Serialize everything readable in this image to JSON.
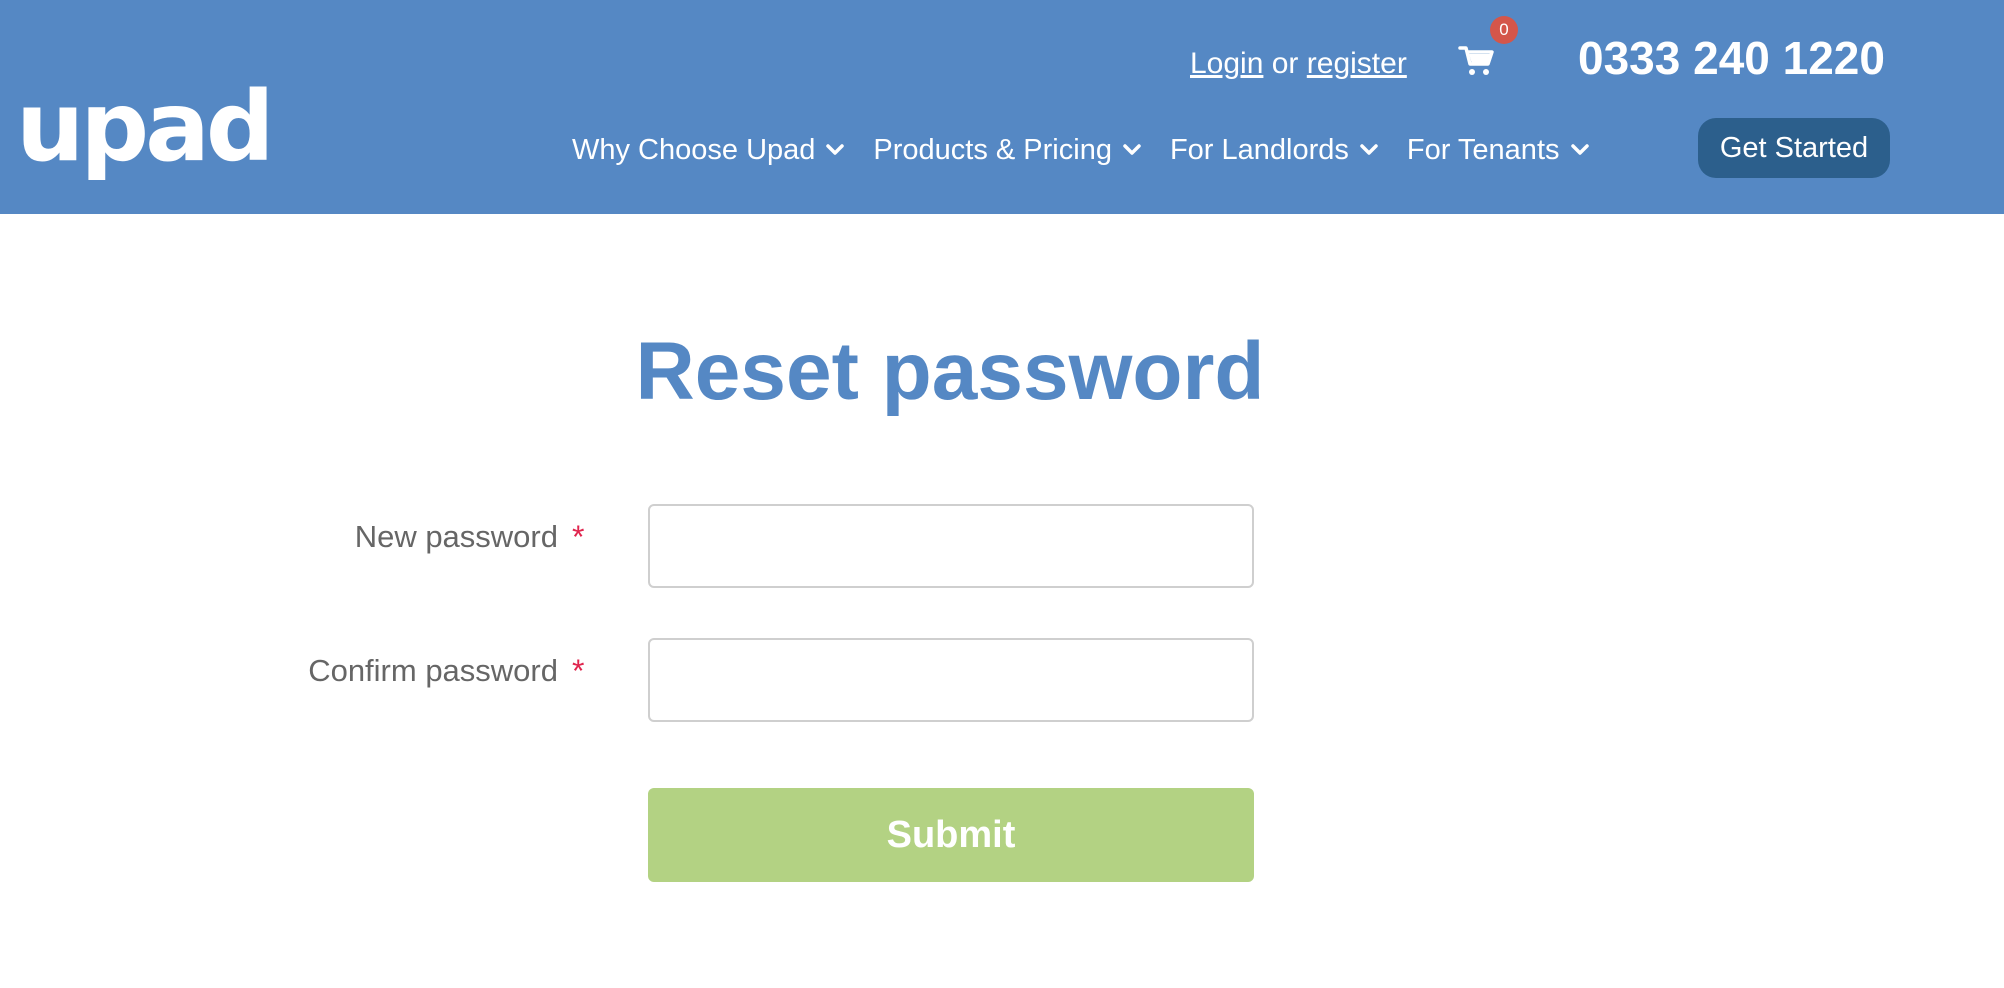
{
  "header": {
    "logo_text": "upad",
    "auth": {
      "login": "Login",
      "separator": "or",
      "register": "register"
    },
    "cart": {
      "icon": "cart-icon",
      "count": "0"
    },
    "phone": "0333 240 1220",
    "nav": [
      {
        "label": "Why Choose Upad",
        "icon": "chevron-down-icon"
      },
      {
        "label": "Products & Pricing",
        "icon": "chevron-down-icon"
      },
      {
        "label": "For Landlords",
        "icon": "chevron-down-icon"
      },
      {
        "label": "For Tenants",
        "icon": "chevron-down-icon"
      }
    ],
    "cta": "Get Started"
  },
  "main": {
    "title": "Reset password",
    "fields": [
      {
        "label": "New password",
        "required_mark": "*",
        "value": ""
      },
      {
        "label": "Confirm password",
        "required_mark": "*",
        "value": ""
      }
    ],
    "submit_label": "Submit"
  },
  "colors": {
    "header_bg": "#5588c4",
    "cta_bg": "#2c5f8c",
    "badge": "#d4564a",
    "title": "#5588c4",
    "required": "#e0254e",
    "submit_bg": "#b3d283"
  }
}
